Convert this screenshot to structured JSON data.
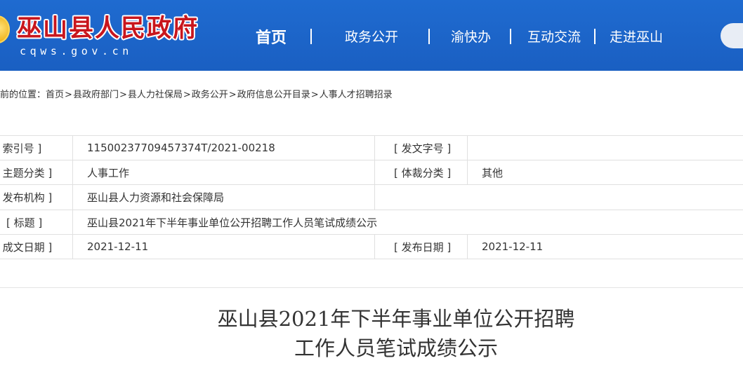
{
  "header": {
    "site_title": "巫山县人民政府",
    "site_domain": "cqws.gov.cn",
    "nav": [
      {
        "label": "首页",
        "active": true
      },
      {
        "label": "政务公开",
        "active": false
      },
      {
        "label": "渝快办",
        "active": false
      },
      {
        "label": "互动交流",
        "active": false
      },
      {
        "label": "走进巫山",
        "active": false
      }
    ],
    "colors": {
      "header_bg": "#1e63c5",
      "title_red": "#c8161d"
    }
  },
  "breadcrumb": {
    "prefix": "前的位置：",
    "items": [
      "首页",
      "县政府部门",
      "县人力社保局",
      "政务公开",
      "政府信息公开目录",
      "人事人才招聘招录"
    ],
    "separator": ">"
  },
  "meta": {
    "rows": [
      {
        "label": "[ 索引号 ]",
        "value": "11500237709457374T/2021-00218",
        "label2": "[ 发文字号 ]",
        "value2": ""
      },
      {
        "label": "[ 主题分类 ]",
        "value": "人事工作",
        "label2": "[ 体裁分类 ]",
        "value2": "其他"
      },
      {
        "label": "[ 发布机构 ]",
        "value": "巫山县人力资源和社会保障局",
        "label2": "",
        "value2": ""
      },
      {
        "label": "[ 标题 ]",
        "value": "巫山县2021年下半年事业单位公开招聘工作人员笔试成绩公示"
      },
      {
        "label": "[ 成文日期 ]",
        "value": "2021-12-11",
        "label2": "[ 发布日期 ]",
        "value2": "2021-12-11"
      }
    ]
  },
  "article": {
    "title_line1": "巫山县2021年下半年事业单位公开招聘",
    "title_line2": "工作人员笔试成绩公示"
  }
}
